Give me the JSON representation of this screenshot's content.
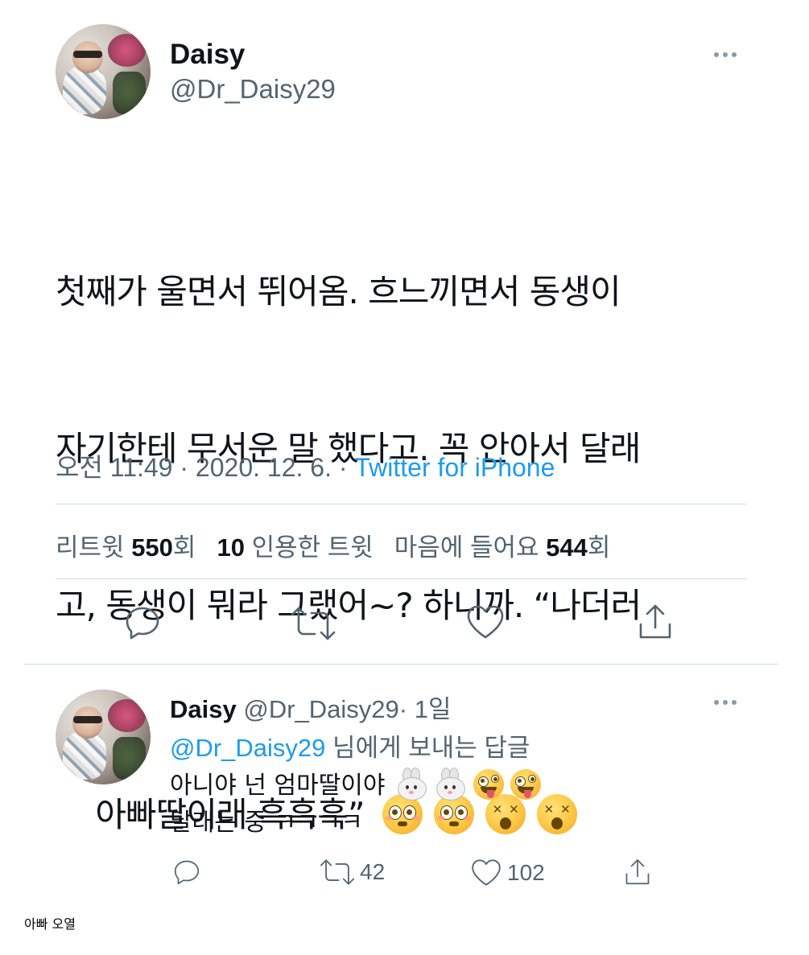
{
  "tweet": {
    "author_name": "Daisy",
    "author_handle": "@Dr_Daisy29",
    "text_lines": [
      "첫째가 울면서 뛰어옴. 흐느끼면서 동생이",
      "자기한테 무서운 말 했다고. 꼭 안아서 달래",
      "고, 동생이 뭐라 그랬어~? 하니까. “나더러",
      "아빠딸이래 흑흑흑”"
    ],
    "emojis": [
      "flushed-face",
      "flushed-face",
      "dizzy-face",
      "dizzy-face"
    ],
    "time": "오전 11:49",
    "date": "2020. 12. 6.",
    "separator": "·",
    "source": "Twitter for iPhone",
    "stats": {
      "retweets_label": "리트윗",
      "retweets_count": "550",
      "retweets_suffix": "회",
      "quotes_count": "10",
      "quotes_label": "인용한 트윗",
      "likes_label": "마음에 들어요",
      "likes_count": "544",
      "likes_suffix": "회"
    },
    "actions": [
      "reply-icon",
      "retweet-icon",
      "like-icon",
      "share-icon"
    ]
  },
  "reply": {
    "author_name": "Daisy",
    "author_handle": "@Dr_Daisy29",
    "separator": "·",
    "age": "1일",
    "replying_to_handle": "@Dr_Daisy29",
    "replying_to_suffix": "님에게 보내는 답글",
    "text_line1": "아니야 넌 엄마딸이야",
    "text_line2": "달래는 중 ㅋㅋㅋㅋ",
    "emojis": [
      "rabbit-face",
      "rabbit-face",
      "zany-face",
      "zany-face"
    ],
    "retweet_count": "42",
    "like_count": "102"
  },
  "caption": "아빠 오열",
  "colors": {
    "link": "#1d9bf0",
    "secondary_text": "#536471",
    "primary_text": "#0f1419",
    "divider": "#cfd9de"
  }
}
